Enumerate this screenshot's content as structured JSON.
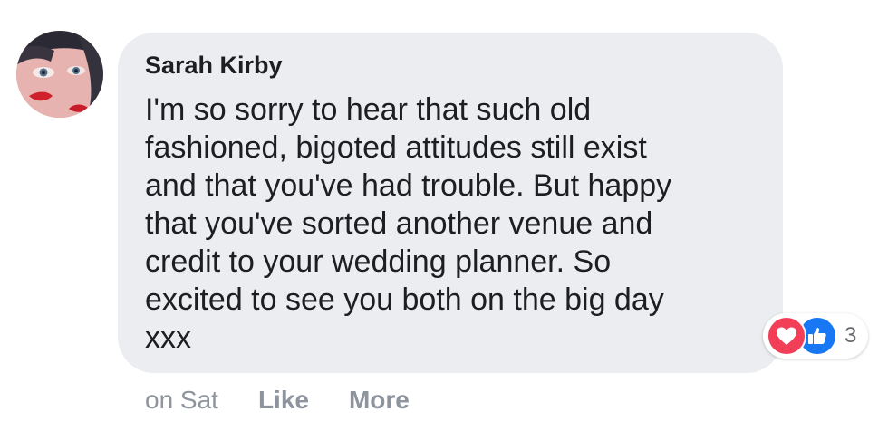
{
  "comment": {
    "author": "Sarah Kirby",
    "text_lines": [
      "I'm so sorry to hear that such old",
      "fashioned, bigoted attitudes still exist",
      "and that you've had trouble. But happy",
      "that you've sorted another venue and",
      "credit to your wedding planner. So",
      "excited to see you both on the big day",
      "xxx"
    ],
    "timestamp": "on Sat",
    "actions": {
      "like_label": "Like",
      "more_label": "More"
    },
    "reactions": {
      "icons": [
        "heart-icon",
        "thumbs-up-icon"
      ],
      "count": "3"
    },
    "colors": {
      "bubble": "#ebedf0",
      "love": "#f33e58",
      "like": "#1877f2",
      "meta_text": "#8d949e"
    }
  }
}
